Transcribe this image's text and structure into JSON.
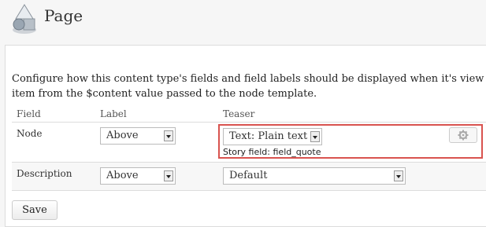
{
  "header": {
    "title": "Page",
    "icon": "page-shapes-icon"
  },
  "intro": {
    "text": "Configure how this content type's fields and field labels should be displayed when it's view item from the $content value passed to the node template."
  },
  "table": {
    "columns": [
      "Field",
      "Label",
      "Teaser"
    ],
    "rows": [
      {
        "field": "Node",
        "label_select": "Above",
        "teaser_select": "Text: Plain text",
        "summary": "Story field: field_quote",
        "highlighted": true
      },
      {
        "field": "Description",
        "label_select": "Above",
        "teaser_select": "Default"
      }
    ]
  },
  "actions": {
    "save_label": "Save",
    "settings_icon": "gear-icon"
  },
  "colors": {
    "highlight": "#d9534f",
    "background": "#f6f6f6"
  }
}
